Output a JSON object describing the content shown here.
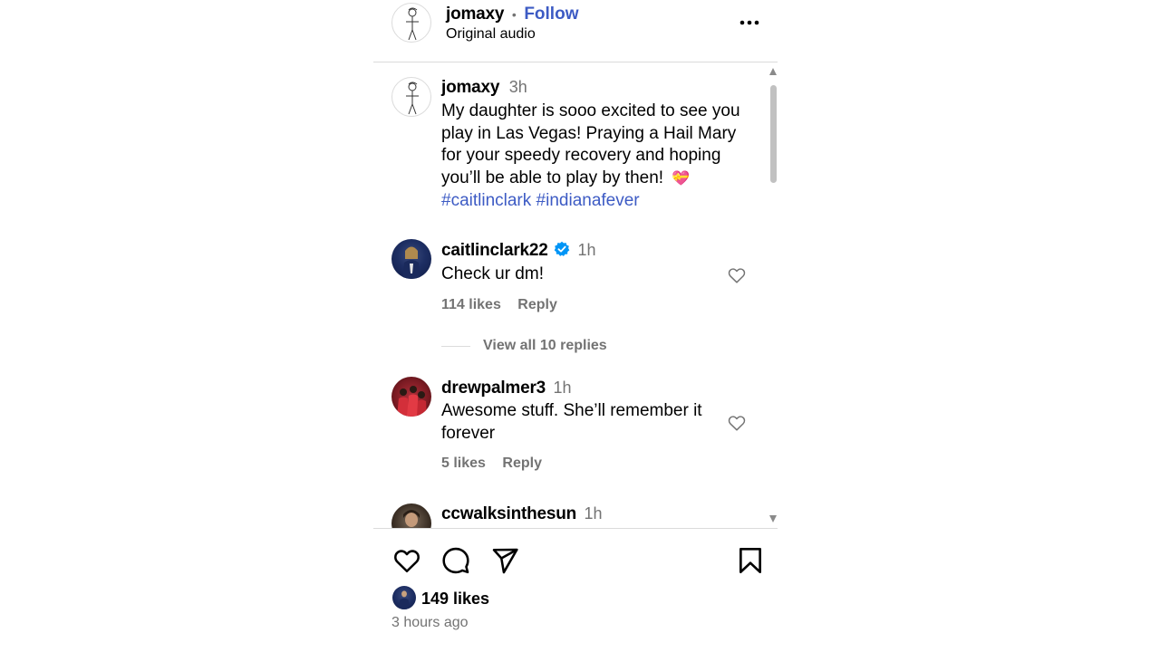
{
  "header": {
    "username": "jomaxy",
    "separator": "•",
    "follow_label": "Follow",
    "subtitle": "Original audio",
    "more_icon": "more-dots-icon"
  },
  "caption": {
    "username": "jomaxy",
    "time": "3h",
    "text": "My daughter is sooo excited to see you play in Las Vegas! Praying a Hail Mary for your speedy recovery and hoping you’ll be able to play by then!",
    "emoji": "💝",
    "hashtags": [
      "#caitlinclark",
      "#indianafever"
    ]
  },
  "comments": [
    {
      "username": "caitlinclark22",
      "verified": true,
      "time": "1h",
      "text": "Check ur dm!",
      "likes": "114 likes",
      "reply_label": "Reply",
      "view_replies": "View all 10 replies"
    },
    {
      "username": "drewpalmer3",
      "time": "1h",
      "text": "Awesome stuff. She’ll remember it forever",
      "likes": "5 likes",
      "reply_label": "Reply"
    },
    {
      "username": "ccwalksinthesun",
      "time": "1h"
    }
  ],
  "actions": {
    "icons": [
      "heart-icon",
      "comment-icon",
      "share-icon",
      "bookmark-icon"
    ],
    "likes": "149 likes",
    "posted": "3 hours ago"
  },
  "colors": {
    "link": "#3d5bc4",
    "secondary_text": "#737373",
    "divider": "#dbdbdb",
    "verified": "#0095f6"
  }
}
